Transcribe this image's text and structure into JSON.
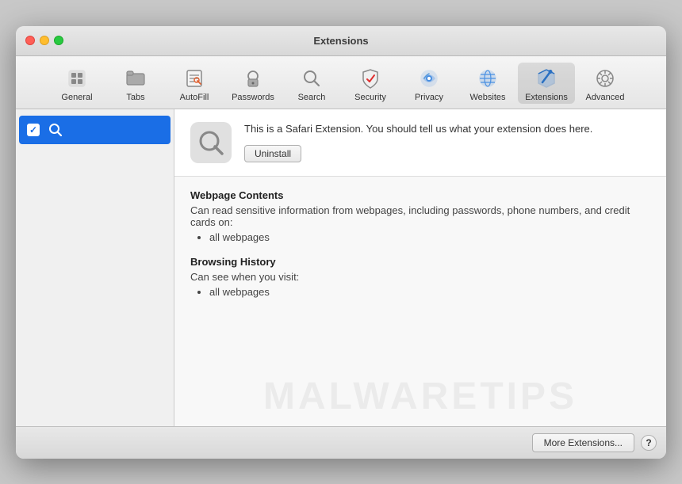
{
  "window": {
    "title": "Extensions"
  },
  "toolbar": {
    "items": [
      {
        "id": "general",
        "label": "General",
        "icon": "general"
      },
      {
        "id": "tabs",
        "label": "Tabs",
        "icon": "tabs"
      },
      {
        "id": "autofill",
        "label": "AutoFill",
        "icon": "autofill"
      },
      {
        "id": "passwords",
        "label": "Passwords",
        "icon": "passwords"
      },
      {
        "id": "search",
        "label": "Search",
        "icon": "search"
      },
      {
        "id": "security",
        "label": "Security",
        "icon": "security"
      },
      {
        "id": "privacy",
        "label": "Privacy",
        "icon": "privacy"
      },
      {
        "id": "websites",
        "label": "Websites",
        "icon": "websites"
      },
      {
        "id": "extensions",
        "label": "Extensions",
        "icon": "extensions",
        "active": true
      },
      {
        "id": "advanced",
        "label": "Advanced",
        "icon": "advanced"
      }
    ]
  },
  "sidebar": {
    "items": [
      {
        "id": "search-ext",
        "label": "",
        "checked": true,
        "selected": true
      }
    ]
  },
  "detail": {
    "extension_description": "This is a Safari Extension. You should tell us what your extension does here.",
    "uninstall_label": "Uninstall",
    "permissions": [
      {
        "title": "Webpage Contents",
        "description": "Can read sensitive information from webpages, including passwords, phone numbers, and credit cards on:",
        "items": [
          "all webpages"
        ]
      },
      {
        "title": "Browsing History",
        "description": "Can see when you visit:",
        "items": [
          "all webpages"
        ]
      }
    ]
  },
  "bottom_bar": {
    "more_extensions_label": "More Extensions...",
    "help_label": "?"
  },
  "watermark": {
    "text": "MALWARETIPS"
  }
}
